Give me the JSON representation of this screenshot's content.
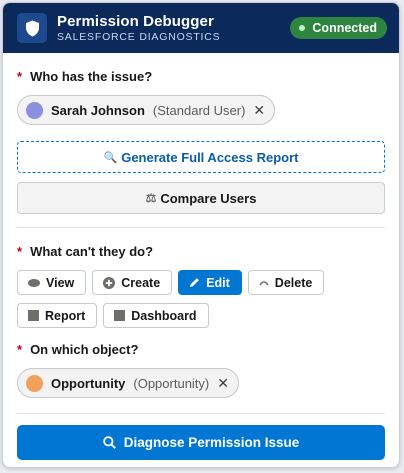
{
  "header": {
    "title": "Permission Debugger",
    "subtitle": "SALESFORCE DIAGNOSTICS",
    "status_label": "Connected",
    "logo_icon": "shield-icon"
  },
  "user_section": {
    "label": "Who has the issue?",
    "required_marker": "*",
    "selected_user": {
      "name": "Sarah Johnson",
      "meta": "(Standard User)",
      "remove": "✕",
      "avatar_color": "#8b8fe0"
    }
  },
  "report_buttons": {
    "generate_icon": "🔍",
    "generate_label": "Generate Full Access Report",
    "compare_icon": "⚖",
    "compare_label": "Compare Users"
  },
  "action_section": {
    "label": "What can't they do?",
    "required_marker": "*",
    "actions": [
      {
        "label": "View",
        "icon": "eye-icon",
        "selected": false
      },
      {
        "label": "Create",
        "icon": "plus-circle-icon",
        "selected": false
      },
      {
        "label": "Edit",
        "icon": "pencil-icon",
        "selected": true
      },
      {
        "label": "Delete",
        "icon": "trash-icon",
        "selected": false
      },
      {
        "label": "Report",
        "icon": "report-icon",
        "selected": false
      },
      {
        "label": "Dashboard",
        "icon": "dashboard-icon",
        "selected": false
      }
    ]
  },
  "object_section": {
    "label": "On which object?",
    "required_marker": "*",
    "selected_object": {
      "name": "Opportunity",
      "meta": "(Opportunity)",
      "remove": "✕",
      "dot_color": "#f0a05a"
    }
  },
  "diagnose_button": {
    "label": "Diagnose Permission Issue",
    "icon": "search-icon"
  },
  "colors": {
    "header_bg": "#0b2a5b",
    "status_green": "#2e8540",
    "primary_blue": "#0176d3",
    "required_red": "#ba0517"
  }
}
